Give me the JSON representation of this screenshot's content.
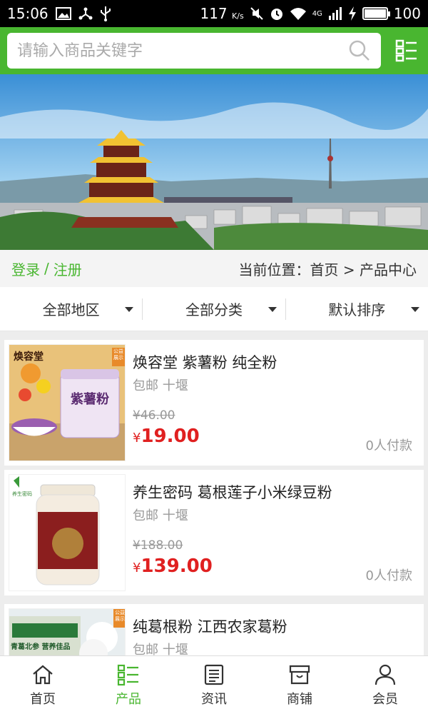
{
  "status_bar": {
    "time": "15:06",
    "network_speed": "117",
    "network_speed_unit": "K/s",
    "signal_type": "4G",
    "battery": "100",
    "left_icons": [
      "image-icon",
      "share-icon",
      "usb-icon"
    ],
    "right_icons": [
      "mute-icon",
      "alarm-icon",
      "wifi-icon",
      "signal-icon",
      "charging-icon",
      "battery-icon"
    ]
  },
  "header": {
    "search_placeholder": "请输入商品关键字",
    "search_icon": "search-icon",
    "menu_icon": "list-menu-icon",
    "color": "#49b630"
  },
  "banner": {
    "scene": "yellow-crane-tower-cityscape"
  },
  "crumb": {
    "login": "登录",
    "separator": "/",
    "register": "注册",
    "position": "当前位置：首页 > 产品中心"
  },
  "filters": [
    {
      "label": "全部地区"
    },
    {
      "label": "全部分类"
    },
    {
      "label": "默认排序"
    }
  ],
  "products": [
    {
      "title": "焕容堂 紫薯粉 纯全粉",
      "meta": "包邮 十堰",
      "original_price": "¥46.00",
      "price_symbol": "¥",
      "price": "19.00",
      "sold": "0人付款",
      "thumb_brand": "焕容堂",
      "thumb_label": "紫薯粉",
      "thumb_badge": "公益展示"
    },
    {
      "title": "养生密码 葛根莲子小米绿豆粉",
      "meta": "包邮 十堰",
      "original_price": "¥188.00",
      "price_symbol": "¥",
      "price": "139.00",
      "sold": "0人付款",
      "thumb_brand": "养生密码"
    },
    {
      "title": "纯葛根粉 江西农家葛粉",
      "meta": "包邮 十堰",
      "thumb_label": "青葛北参 营养佳品",
      "thumb_badge": "公益展示"
    }
  ],
  "tabbar": [
    {
      "label": "首页",
      "icon": "home-icon",
      "active": false
    },
    {
      "label": "产品",
      "icon": "product-list-icon",
      "active": true
    },
    {
      "label": "资讯",
      "icon": "news-icon",
      "active": false
    },
    {
      "label": "商铺",
      "icon": "shop-icon",
      "active": false
    },
    {
      "label": "会员",
      "icon": "user-icon",
      "active": false
    }
  ]
}
